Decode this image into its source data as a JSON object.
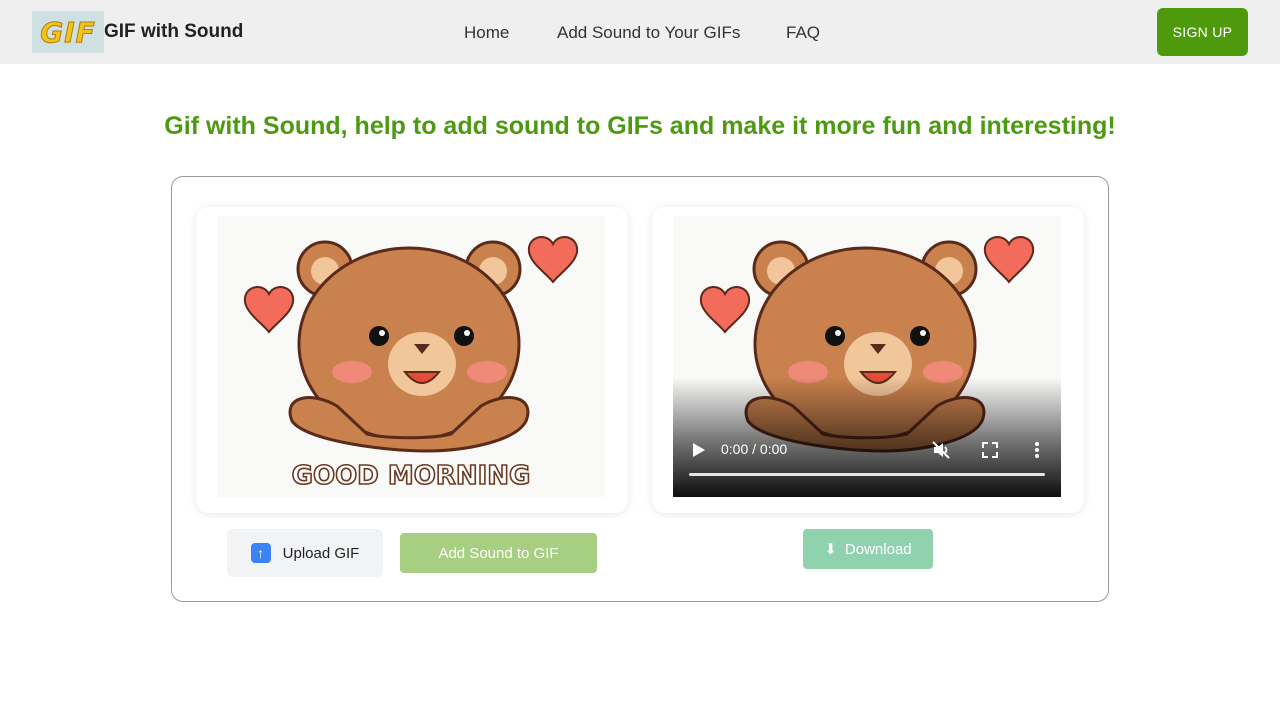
{
  "header": {
    "logo_text": "GIF",
    "brand": "GIF with Sound",
    "nav": [
      "Home",
      "Add Sound to Your GIFs",
      "FAQ"
    ],
    "signup": "SIGN UP"
  },
  "hero": {
    "headline": "Gif with Sound, help to add sound to GIFs and make it more fun and interesting!"
  },
  "gif_preview": {
    "caption": "GOOD MORNING"
  },
  "video_player": {
    "time": "0:00 / 0:00",
    "progress": 0,
    "muted": true
  },
  "actions": {
    "upload_label": "Upload GIF",
    "add_sound_label": "Add Sound to GIF",
    "download_label": "Download"
  },
  "colors": {
    "brand_green": "#4f9a0c",
    "headline_green": "#4d9a12",
    "add_sound_bg": "#a7cf82",
    "download_bg": "#8fd2ad"
  }
}
